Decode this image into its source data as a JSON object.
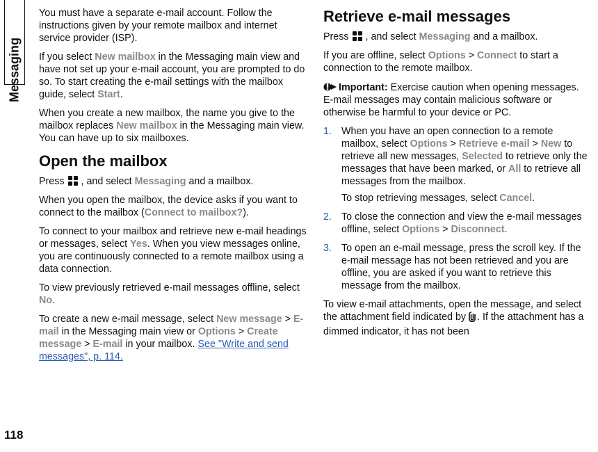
{
  "sideTab": "Messaging",
  "pageNumber": "118",
  "left": {
    "p1a": "You must have a separate e-mail account. Follow the instructions given by your remote mailbox and internet service provider (ISP).",
    "p2a": "If you select ",
    "p2b": "New mailbox",
    "p2c": " in the Messaging main view and have not set up your e-mail account, you are prompted to do so. To start creating the e-mail settings with the mailbox guide, select ",
    "p2d": "Start",
    "p2e": ".",
    "p3a": "When you create a new mailbox, the name you give to the mailbox replaces ",
    "p3b": "New mailbox",
    "p3c": " in the Messaging main view. You can have up to six mailboxes.",
    "h2": "Open the mailbox",
    "p4a": "Press ",
    "p4b": " , and select ",
    "p4c": "Messaging",
    "p4d": " and a mailbox.",
    "p5a": "When you open the mailbox, the device asks if you want to connect to the mailbox (",
    "p5b": "Connect to mailbox?",
    "p5c": ").",
    "p6a": "To connect to your mailbox and retrieve new e-mail headings or messages, select ",
    "p6b": "Yes",
    "p6c": ". When you view messages online, you are continuously connected to a remote mailbox using a data connection.",
    "p7a": "To view previously retrieved e-mail messages offline, select ",
    "p7b": "No",
    "p7c": ".",
    "p8a": "To create a new e-mail message, select ",
    "p8b": "New message",
    "p8c": " > ",
    "p8d": "E-mail",
    "p8e": " in the Messaging main view or ",
    "p8f": "Options",
    "p8g": " > ",
    "p8h": "Create message",
    "p8i": " > ",
    "p8j": "E-mail",
    "p8k": " in your mailbox. ",
    "xref": "See \"Write and send messages\", p. 114."
  },
  "right": {
    "h2": "Retrieve e-mail messages",
    "p1a": "Press ",
    "p1b": " , and select ",
    "p1c": "Messaging",
    "p1d": " and a mailbox.",
    "p2a": "If you are offline, select ",
    "p2b": "Options",
    "p2c": " > ",
    "p2d": "Connect",
    "p2e": " to start a connection to the remote mailbox.",
    "imp_label": "Important:",
    "imp_body": "  Exercise caution when opening messages. E-mail messages may contain malicious software or otherwise be harmful to your device or PC.",
    "s1a": "When you have an open connection to a remote mailbox, select ",
    "s1b": "Options",
    "s1c": " > ",
    "s1d": "Retrieve e-mail",
    "s1e": " > ",
    "s1f": "New",
    "s1g": " to retrieve all new messages, ",
    "s1h": "Selected",
    "s1i": " to retrieve only the messages that have been marked, or ",
    "s1j": "All",
    "s1k": " to retrieve all messages from the mailbox.",
    "s1_p2a": "To stop retrieving messages, select ",
    "s1_p2b": "Cancel",
    "s1_p2c": ".",
    "s2a": "To close the connection and view the e-mail messages offline, select ",
    "s2b": "Options",
    "s2c": " > ",
    "s2d": "Disconnect",
    "s2e": ".",
    "s3a": "To open an e-mail message, press the scroll key. If the e-mail message has not been retrieved and you are offline, you are asked if you want to retrieve this message from the mailbox.",
    "p_last_a": "To view e-mail attachments, open the message, and select the attachment field indicated by ",
    "p_last_b": ". If the attachment has a dimmed indicator, it has not been"
  }
}
